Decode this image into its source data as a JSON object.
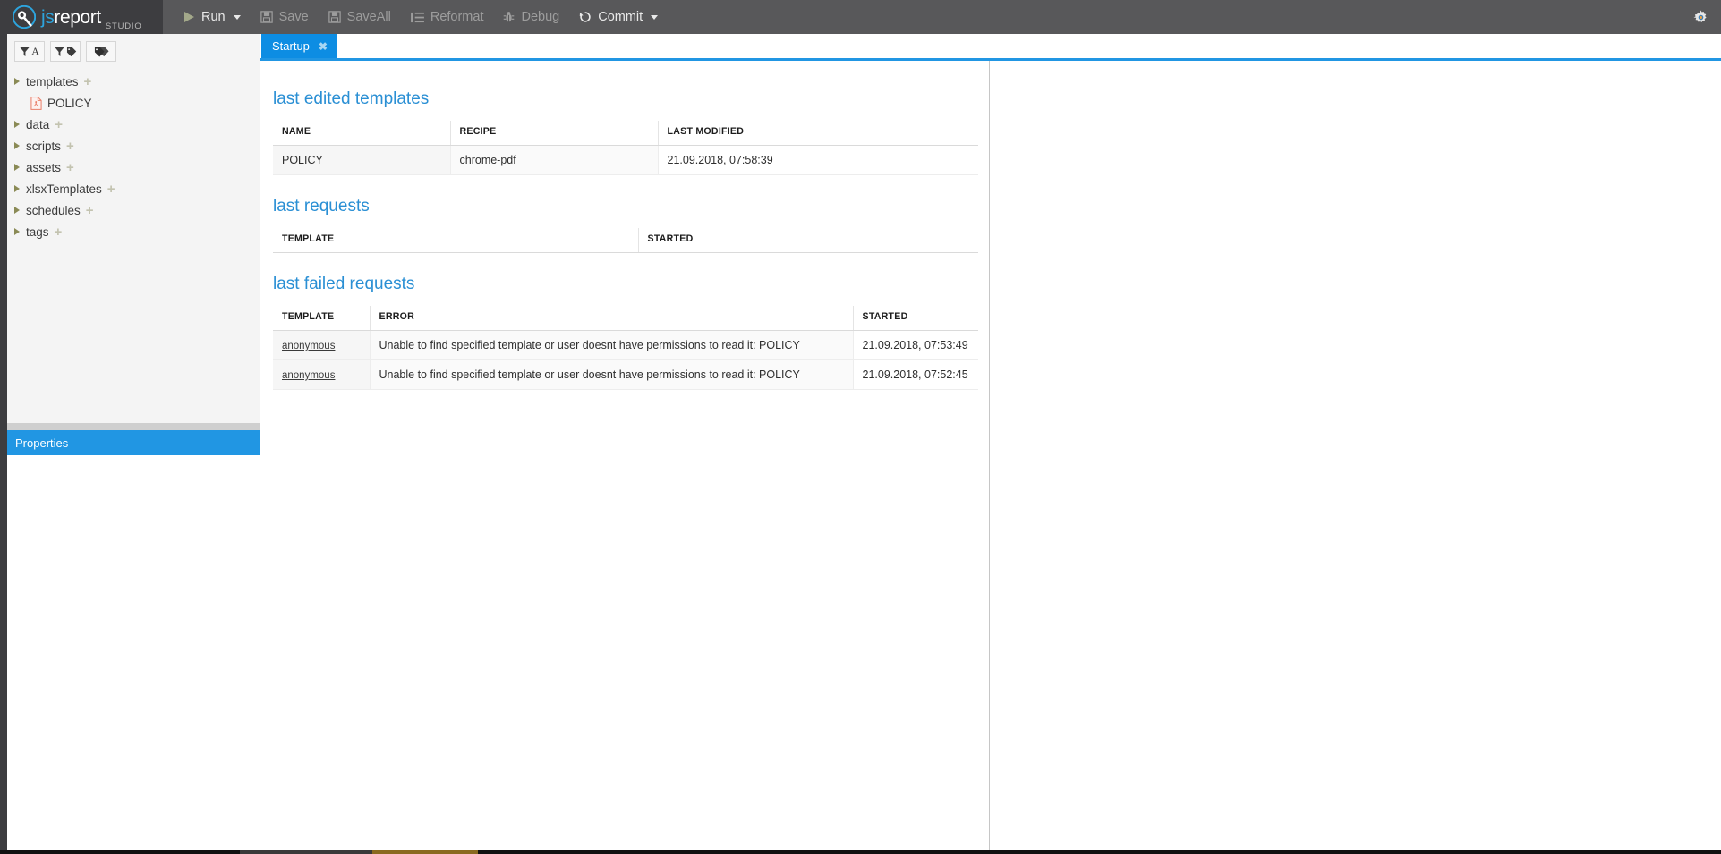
{
  "app": {
    "brand_js": "js",
    "brand_report": "report",
    "brand_studio": "STUDIO"
  },
  "toolbar": {
    "buttons": [
      {
        "label": "Run",
        "icon": "play-icon",
        "enabled": true,
        "caret": true
      },
      {
        "label": "Save",
        "icon": "floppy-icon",
        "enabled": false,
        "caret": false
      },
      {
        "label": "SaveAll",
        "icon": "floppy-icon",
        "enabled": false,
        "caret": false
      },
      {
        "label": "Reformat",
        "icon": "reformat-icon",
        "enabled": false,
        "caret": false
      },
      {
        "label": "Debug",
        "icon": "bug-icon",
        "enabled": false,
        "caret": false
      },
      {
        "label": "Commit",
        "icon": "history-icon",
        "enabled": true,
        "caret": true
      }
    ],
    "settings_icon": "gear-icon"
  },
  "sidebar": {
    "filter_buttons": [
      {
        "name": "sort-by-name-button",
        "icon": "funnel-letter-icon"
      },
      {
        "name": "filter-by-tag-button",
        "icon": "funnel-tag-icon"
      },
      {
        "name": "tags-button",
        "icon": "tags-icon"
      }
    ],
    "tree": [
      {
        "label": "templates",
        "type": "folder",
        "plus": "+",
        "indent": 0
      },
      {
        "label": "POLICY",
        "type": "pdf",
        "plus": "",
        "indent": 1
      },
      {
        "label": "data",
        "type": "folder",
        "plus": "+",
        "indent": 0
      },
      {
        "label": "scripts",
        "type": "folder",
        "plus": "+",
        "indent": 0
      },
      {
        "label": "assets",
        "type": "folder",
        "plus": "+",
        "indent": 0
      },
      {
        "label": "xlsxTemplates",
        "type": "folder",
        "plus": "+",
        "indent": 0
      },
      {
        "label": "schedules",
        "type": "folder",
        "plus": "+",
        "indent": 0
      },
      {
        "label": "tags",
        "type": "folder",
        "plus": "+",
        "indent": 0
      }
    ],
    "properties_title": "Properties"
  },
  "tabs": [
    {
      "label": "Startup",
      "close": "✖",
      "active": true
    }
  ],
  "startup": {
    "last_edited_templates": {
      "title": "last edited templates",
      "columns": [
        "NAME",
        "RECIPE",
        "LAST MODIFIED"
      ],
      "rows": [
        {
          "name": "POLICY",
          "recipe": "chrome-pdf",
          "last_modified": "21.09.2018, 07:58:39"
        }
      ]
    },
    "last_requests": {
      "title": "last requests",
      "columns": [
        "TEMPLATE",
        "STARTED"
      ],
      "rows": []
    },
    "last_failed_requests": {
      "title": "last failed requests",
      "columns": [
        "TEMPLATE",
        "ERROR",
        "STARTED"
      ],
      "rows": [
        {
          "template": "anonymous",
          "error": "Unable to find specified template or user doesnt have permissions to read it: POLICY",
          "started": "21.09.2018, 07:53:49"
        },
        {
          "template": "anonymous",
          "error": "Unable to find specified template or user doesnt have permissions to read it: POLICY",
          "started": "21.09.2018, 07:52:45"
        }
      ]
    }
  },
  "colors": {
    "accent_blue": "#2196e3",
    "toolbar_bg": "#58585a",
    "brand_bg": "#3d3d40",
    "heading_blue": "#2a8fd4",
    "tab_blue": "#0d8de3"
  }
}
